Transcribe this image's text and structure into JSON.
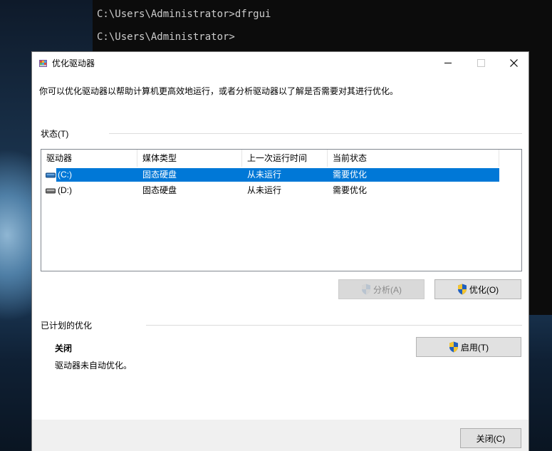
{
  "console": {
    "line1": "C:\\Users\\Administrator>dfrgui",
    "line2": "C:\\Users\\Administrator>"
  },
  "window": {
    "title": "优化驱动器",
    "description": "你可以优化驱动器以帮助计算机更高效地运行，或者分析驱动器以了解是否需要对其进行优化。",
    "controls": {
      "minimize": "—",
      "maximize": "☐",
      "close": "✕"
    }
  },
  "status_group": {
    "label": "状态(T)",
    "columns": [
      "驱动器",
      "媒体类型",
      "上一次运行时间",
      "当前状态"
    ],
    "rows": [
      {
        "drive": "(C:)",
        "media": "固态硬盘",
        "last_run": "从未运行",
        "status": "需要优化",
        "selected": true
      },
      {
        "drive": "(D:)",
        "media": "固态硬盘",
        "last_run": "从未运行",
        "status": "需要优化",
        "selected": false
      }
    ],
    "analyze_button": "分析(A)",
    "optimize_button": "优化(O)"
  },
  "scheduled": {
    "label": "已计划的优化",
    "state": "关闭",
    "description": "驱动器未自动优化。",
    "enable_button": "启用(T)"
  },
  "footer": {
    "close_button": "关闭(C)"
  },
  "colors": {
    "selection": "#0078d7",
    "window_bg": "#ffffff",
    "footer_bg": "#f0f0f0"
  }
}
